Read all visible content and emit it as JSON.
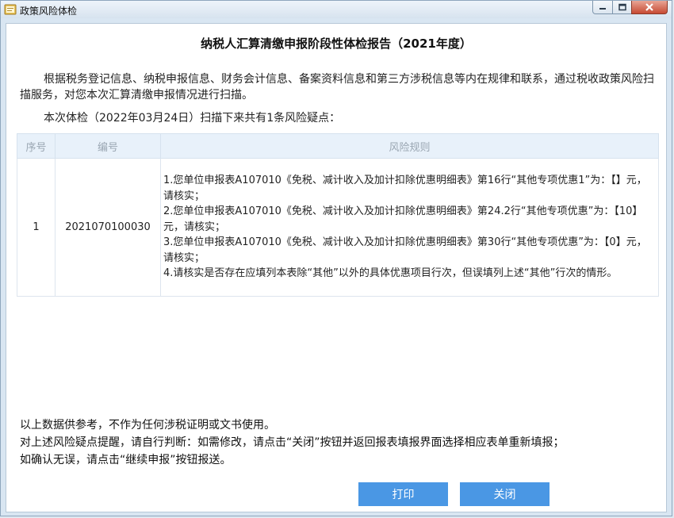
{
  "window": {
    "title": "政策风险体检"
  },
  "report": {
    "title": "纳税人汇算清缴申报阶段性体检报告（2021年度）",
    "intro": "根据税务登记信息、纳税申报信息、财务会计信息、备案资料信息和第三方涉税信息等内在规律和联系，通过税收政策风险扫描服务，对您本次汇算清缴申报情况进行扫描。",
    "summary": "本次体检（2022年03月24日）扫描下来共有1条风险疑点："
  },
  "table": {
    "headers": [
      "序号",
      "编号",
      "风险规则"
    ],
    "rows": [
      {
        "seq": "1",
        "code": "2021070100030",
        "rules": [
          "1.您单位申报表A107010《免税、减计收入及加计扣除优惠明细表》第16行“其他专项优惠1”为：【】元，请核实；",
          "2.您单位申报表A107010《免税、减计收入及加计扣除优惠明细表》第24.2行“其他专项优惠”为：【10】元，请核实；",
          "3.您单位申报表A107010《免税、减计收入及加计扣除优惠明细表》第30行“其他专项优惠”为：【0】元，请核实；",
          "4.请核实是否存在应填列本表除“其他”以外的具体优惠项目行次，但误填列上述“其他”行次的情形。"
        ]
      }
    ]
  },
  "footer": {
    "line1": "以上数据供参考，不作为任何涉税证明或文书使用。",
    "line2": "对上述风险疑点提醒，请自行判断：如需修改，请点击“关闭”按钮并返回报表填报界面选择相应表单重新填报；",
    "line3": "如确认无误，请点击“继续申报”按钮报送。"
  },
  "buttons": {
    "print": "打印",
    "close": "关闭"
  },
  "icons": {
    "app": "app-icon",
    "minimize": "minimize-icon",
    "maximize": "maximize-icon",
    "close": "close-icon"
  },
  "colors": {
    "accent": "#4a97e4",
    "header_bg": "#e8f1fa"
  }
}
